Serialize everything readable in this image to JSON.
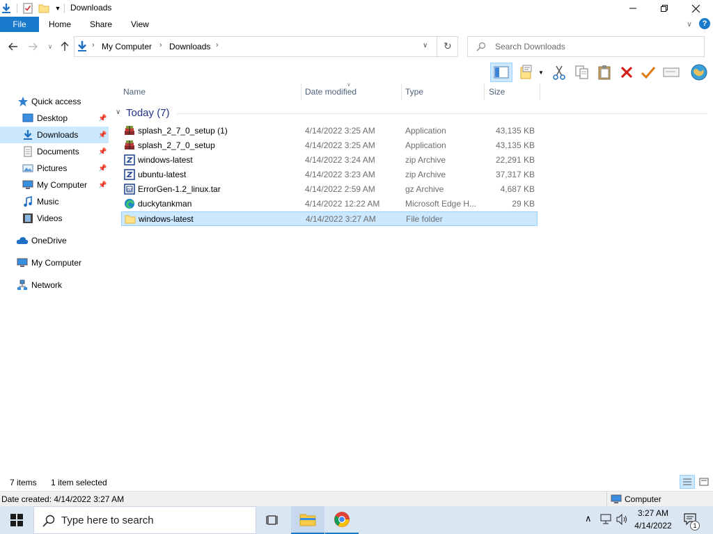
{
  "window": {
    "title": "Downloads"
  },
  "ribbon": {
    "file": "File",
    "tabs": [
      "Home",
      "Share",
      "View"
    ]
  },
  "address": {
    "segments": [
      "My Computer",
      "Downloads"
    ]
  },
  "search": {
    "placeholder": "Search Downloads"
  },
  "nav": {
    "quick_access": "Quick access",
    "items": [
      {
        "label": "Desktop",
        "icon": "desktop-icon",
        "pinned": true
      },
      {
        "label": "Downloads",
        "icon": "downloads-icon",
        "pinned": true,
        "selected": true
      },
      {
        "label": "Documents",
        "icon": "documents-icon",
        "pinned": true
      },
      {
        "label": "Pictures",
        "icon": "pictures-icon",
        "pinned": true
      },
      {
        "label": "My Computer",
        "icon": "computer-icon",
        "pinned": true
      },
      {
        "label": "Music",
        "icon": "music-icon",
        "pinned": false
      },
      {
        "label": "Videos",
        "icon": "videos-icon",
        "pinned": false
      }
    ],
    "onedrive": "OneDrive",
    "computer": "My Computer",
    "network": "Network"
  },
  "columns": {
    "name": "Name",
    "date": "Date modified",
    "type": "Type",
    "size": "Size"
  },
  "group": {
    "label": "Today (7)"
  },
  "files": [
    {
      "name": "splash_2_7_0_setup (1)",
      "date": "4/14/2022 3:25 AM",
      "type": "Application",
      "size": "43,135 KB",
      "icon": "installer-icon"
    },
    {
      "name": "splash_2_7_0_setup",
      "date": "4/14/2022 3:25 AM",
      "type": "Application",
      "size": "43,135 KB",
      "icon": "installer-icon"
    },
    {
      "name": "windows-latest",
      "date": "4/14/2022 3:24 AM",
      "type": "zip Archive",
      "size": "22,291 KB",
      "icon": "zip-icon"
    },
    {
      "name": "ubuntu-latest",
      "date": "4/14/2022 3:23 AM",
      "type": "zip Archive",
      "size": "37,317 KB",
      "icon": "zip-icon"
    },
    {
      "name": "ErrorGen-1.2_linux.tar",
      "date": "4/14/2022 2:59 AM",
      "type": "gz Archive",
      "size": "4,687 KB",
      "icon": "archive-icon"
    },
    {
      "name": "duckytankman",
      "date": "4/14/2022 12:22 AM",
      "type": "Microsoft Edge H...",
      "size": "29 KB",
      "icon": "edge-icon"
    },
    {
      "name": "windows-latest",
      "date": "4/14/2022 3:27 AM",
      "type": "File folder",
      "size": "",
      "icon": "folder-icon",
      "selected": true
    }
  ],
  "status": {
    "count": "7 items",
    "selected": "1 item selected"
  },
  "details": {
    "created": "Date created: 4/14/2022 3:27 AM",
    "location": "Computer"
  },
  "taskbar": {
    "search_placeholder": "Type here to search",
    "time": "3:27 AM",
    "date": "4/14/2022",
    "notifications": "1"
  },
  "colors": {
    "accent": "#1979ca",
    "selection": "#cce8ff",
    "selection_border": "#99d1ff",
    "group_header": "#1e3287"
  }
}
